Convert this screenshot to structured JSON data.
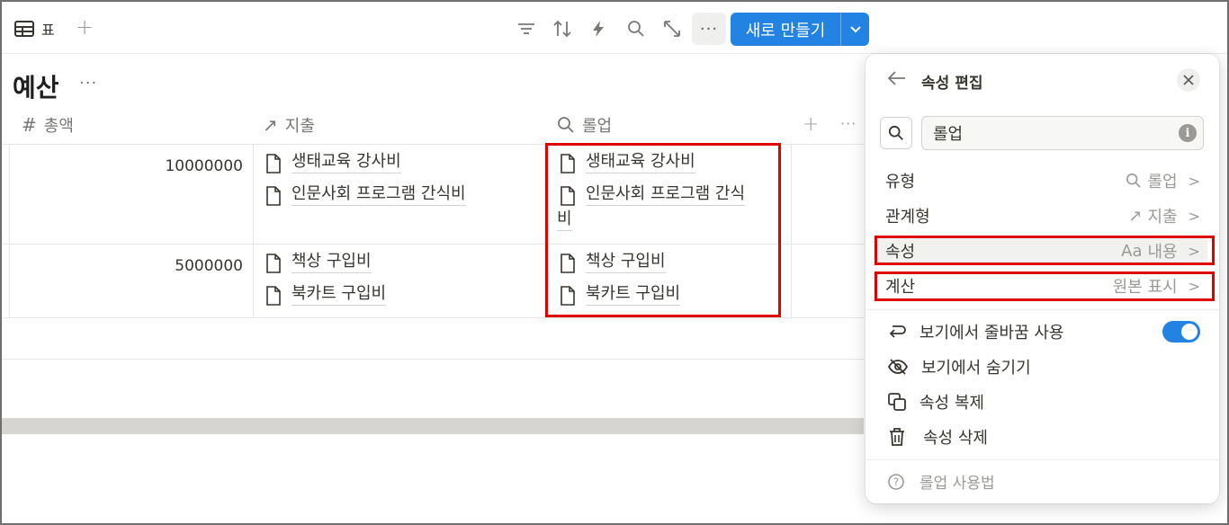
{
  "toolbar": {
    "view_name": "표",
    "add_view": "+",
    "more": "···",
    "new_label": "새로 만들기"
  },
  "database": {
    "title": "예산",
    "title_more": "···"
  },
  "columns": [
    {
      "icon": "#",
      "label": "총액"
    },
    {
      "icon": "↗",
      "label": "지출"
    },
    {
      "icon": "search",
      "label": "롤업"
    }
  ],
  "add_column": "+",
  "column_more": "···",
  "rows": [
    {
      "total": "10000000",
      "expenses": [
        "생태교육 강사비",
        "인문사회 프로그램 간식비"
      ],
      "rollup": [
        "생태교육 강사비",
        "인문사회 프로그램 간식",
        "비"
      ]
    },
    {
      "total": "5000000",
      "expenses": [
        "책상 구입비",
        "북카트 구입비"
      ],
      "rollup": [
        "책상 구입비",
        "북카트 구입비"
      ]
    }
  ],
  "panel": {
    "title": "속성 편집",
    "search_value": "롤업",
    "info": "i",
    "rows": [
      {
        "label": "유형",
        "value": "롤업"
      },
      {
        "label": "관계형",
        "value": "지출"
      },
      {
        "label": "속성",
        "value_prefix": "Aa",
        "value": "내용"
      },
      {
        "label": "계산",
        "value": "원본 표시"
      }
    ],
    "actions": {
      "wrap": "보기에서 줄바꿈 사용",
      "hide": "보기에서 숨기기",
      "duplicate": "속성 복제",
      "delete": "속성 삭제"
    },
    "wrap_enabled": true,
    "help": "롤업 사용법"
  },
  "colors": {
    "accent": "#2383e2",
    "highlight": "#e00000"
  }
}
